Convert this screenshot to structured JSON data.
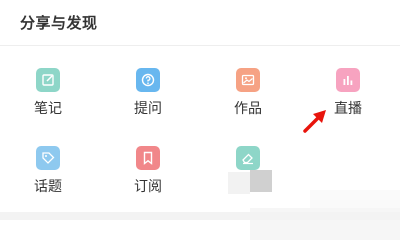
{
  "section": {
    "title": "分享与发现"
  },
  "grid": {
    "items": [
      {
        "label": "笔记",
        "icon": "edit-note-icon",
        "color": "#8ed6c8"
      },
      {
        "label": "提问",
        "icon": "question-icon",
        "color": "#68b7ef"
      },
      {
        "label": "作品",
        "icon": "image-icon",
        "color": "#f6a284"
      },
      {
        "label": "直播",
        "icon": "bar-chart-icon",
        "color": "#f7a3c0"
      },
      {
        "label": "话题",
        "icon": "tag-icon",
        "color": "#8ec9ef"
      },
      {
        "label": "订阅",
        "icon": "bookmark-icon",
        "color": "#f1878a"
      },
      {
        "label": "",
        "icon": "eraser-icon",
        "color": "#8ed6c8"
      }
    ]
  },
  "annotation": {
    "arrow_color": "#e8140c"
  }
}
